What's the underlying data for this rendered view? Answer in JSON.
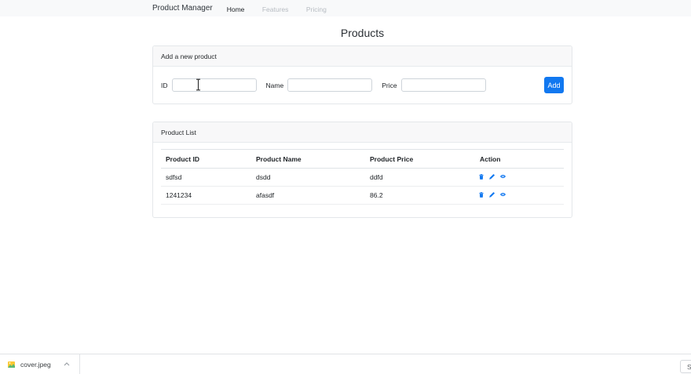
{
  "navbar": {
    "brand": "Product Manager",
    "links": [
      {
        "label": "Home",
        "state": "active"
      },
      {
        "label": "Features",
        "state": "disabled"
      },
      {
        "label": "Pricing",
        "state": "disabled"
      }
    ]
  },
  "page": {
    "title": "Products"
  },
  "add_product": {
    "title": "Add a new product",
    "fields": [
      {
        "label": "ID",
        "value": ""
      },
      {
        "label": "Name",
        "value": ""
      },
      {
        "label": "Price",
        "value": ""
      }
    ],
    "submit_label": "Add"
  },
  "product_list": {
    "title": "Product List",
    "columns": [
      "Product ID",
      "Product Name",
      "Product Price",
      "Action"
    ],
    "rows": [
      {
        "id": "sdfsd",
        "name": "dsdd",
        "price": "ddfd"
      },
      {
        "id": "1241234",
        "name": "afasdf",
        "price": "86.2"
      }
    ],
    "row_actions": [
      "delete",
      "edit",
      "view"
    ]
  },
  "download_bar": {
    "filename": "cover.jpeg",
    "show_all_label": "Show all"
  },
  "colors": {
    "primary": "#1178f0",
    "navbar_bg": "#f8f9fa",
    "muted_link": "#b7bcc2",
    "card_border": "#e4e7ea",
    "table_border": "#dfe3e7"
  }
}
